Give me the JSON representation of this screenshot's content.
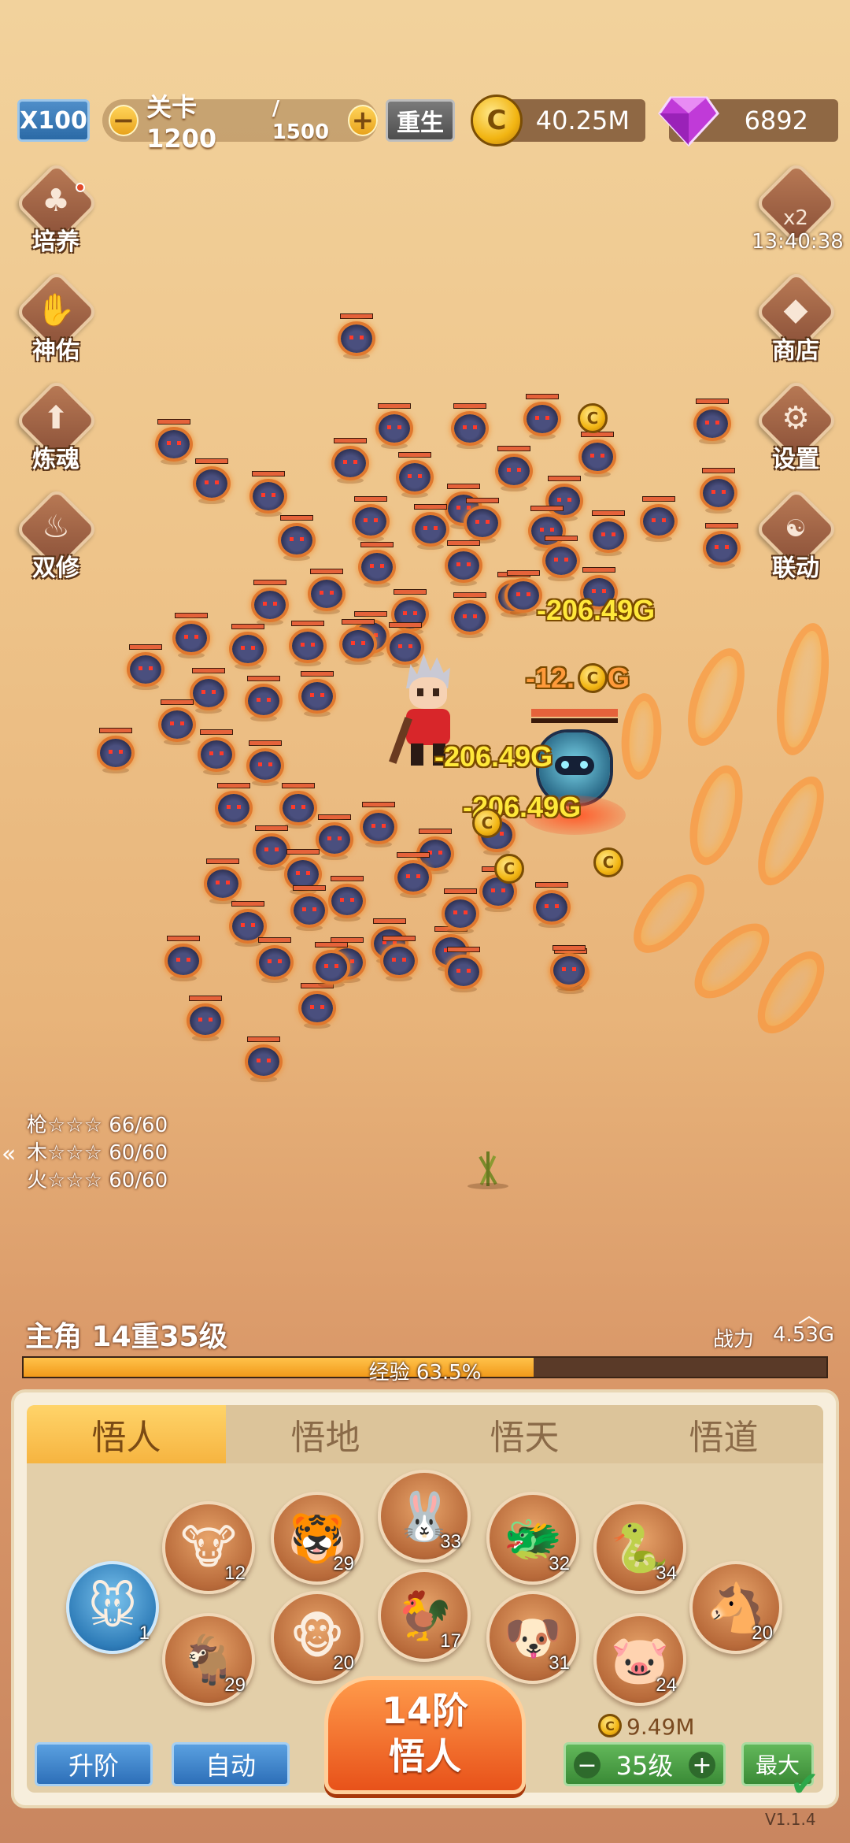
{
  "topbar": {
    "speed_label": "X100",
    "stage_label": "关卡 1200",
    "stage_max": "/ 1500",
    "minus": "−",
    "plus": "+",
    "rebirth_label": "重生",
    "gold": "40.25M",
    "gems": "6892"
  },
  "side_left": [
    {
      "label": "培养",
      "icon": "clover-icon"
    },
    {
      "label": "神佑",
      "icon": "blessing-icon"
    },
    {
      "label": "炼魂",
      "icon": "refine-soul-icon"
    },
    {
      "label": "双修",
      "icon": "dual-cultivation-icon"
    }
  ],
  "side_right": [
    {
      "label": "x2",
      "icon": "double-reward-icon"
    },
    {
      "label": "商店",
      "icon": "shop-icon"
    },
    {
      "label": "设置",
      "icon": "gear-icon"
    },
    {
      "label": "联动",
      "icon": "crossover-icon"
    }
  ],
  "timer": "13:40:38",
  "damage_numbers": [
    {
      "text": "-206.49G",
      "color": "yellow"
    },
    {
      "text": "-12.",
      "color": "orange"
    },
    {
      "text": "G",
      "color": "orange"
    },
    {
      "text": "-206.49G",
      "color": "yellow"
    },
    {
      "text": "-206.49G",
      "color": "yellow"
    }
  ],
  "skills": [
    {
      "text": "枪☆☆☆ 66/60"
    },
    {
      "text": "木☆☆☆ 60/60"
    },
    {
      "text": "火☆☆☆ 60/60"
    }
  ],
  "hero": {
    "title": "主角 14重35级",
    "power_label": "战力",
    "power_value": "4.53G",
    "exp_label": "经验 63.5%",
    "exp_fraction": 0.635
  },
  "tabs": [
    "悟人",
    "悟地",
    "悟天",
    "悟道"
  ],
  "zodiac": [
    {
      "name": "rat-icon",
      "glyph": "🐭",
      "level": "1"
    },
    {
      "name": "ox-icon",
      "glyph": "🐮",
      "level": "12"
    },
    {
      "name": "tiger-icon",
      "glyph": "🐯",
      "level": "29"
    },
    {
      "name": "rabbit-icon",
      "glyph": "🐰",
      "level": "33"
    },
    {
      "name": "dragon-icon",
      "glyph": "🐲",
      "level": "32"
    },
    {
      "name": "snake-icon",
      "glyph": "🐍",
      "level": "34"
    },
    {
      "name": "horse-icon",
      "glyph": "🐴",
      "level": "20"
    },
    {
      "name": "goat-icon",
      "glyph": "🐐",
      "level": "29"
    },
    {
      "name": "monkey-icon",
      "glyph": "🐵",
      "level": "20"
    },
    {
      "name": "rooster-icon",
      "glyph": "🐓",
      "level": "17"
    },
    {
      "name": "dog-icon",
      "glyph": "🐶",
      "level": "31"
    },
    {
      "name": "pig-icon",
      "glyph": "🐷",
      "level": "24"
    }
  ],
  "actions": {
    "upgrade_label": "升阶",
    "auto_label": "自动",
    "big_line1": "14阶",
    "big_line2": "悟人",
    "cost": "9.49M",
    "level_label": "35级",
    "max_label": "最大"
  },
  "version": "V1.1.4",
  "colors": {
    "accent": "#f6b440",
    "gold": "#f2b512",
    "gem": "#c040e0",
    "damage": "#ffe83a"
  }
}
